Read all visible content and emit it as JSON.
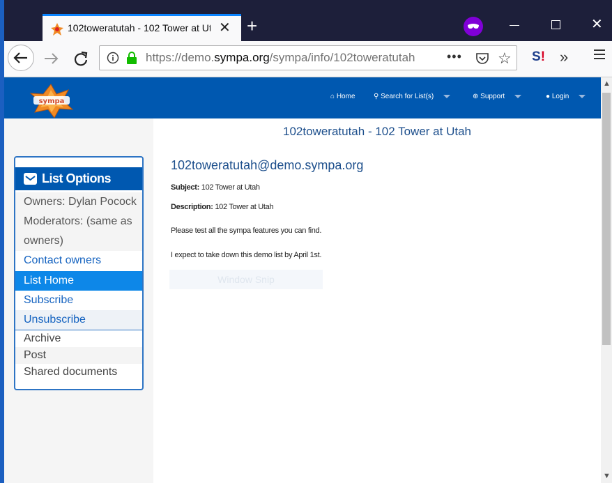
{
  "browser": {
    "tab_title": "102toweratutah - 102 Tower at Utah",
    "url_host_prefix": "https://demo.",
    "url_host_domain": "sympa.org",
    "url_path": "/sympa/info/102toweratutah",
    "more_label": "•••",
    "overflow_label": "»"
  },
  "site": {
    "nav": {
      "home": "Home",
      "search": "Search for List(s)",
      "support": "Support",
      "login": "Login"
    }
  },
  "sidebar": {
    "title": "List Options",
    "items": [
      {
        "label": "Owners: Dylan Pocock"
      },
      {
        "label": "Moderators: (same as"
      },
      {
        "label": "owners)"
      },
      {
        "label": "Contact owners"
      },
      {
        "label": "List Home"
      },
      {
        "label": "Subscribe"
      },
      {
        "label": "Unsubscribe"
      },
      {
        "label": "Archive"
      },
      {
        "label": "Post"
      },
      {
        "label": "Shared documents"
      }
    ]
  },
  "main": {
    "title": "102toweratutah - 102 Tower at Utah",
    "address": "102toweratutah@demo.sympa.org",
    "subject_label": "Subject:",
    "subject_value": " 102 Tower at Utah",
    "description_label": "Description:",
    "description_value": " 102 Tower at Utah",
    "line1": "Please test all the sympa features you can find.",
    "line2": "I expect to take down this demo list by April 1st.",
    "snip_label": "Window Snip"
  },
  "colors": {
    "header_blue": "#0058b0",
    "active_item": "#0d87e8",
    "link": "#1563c0"
  }
}
